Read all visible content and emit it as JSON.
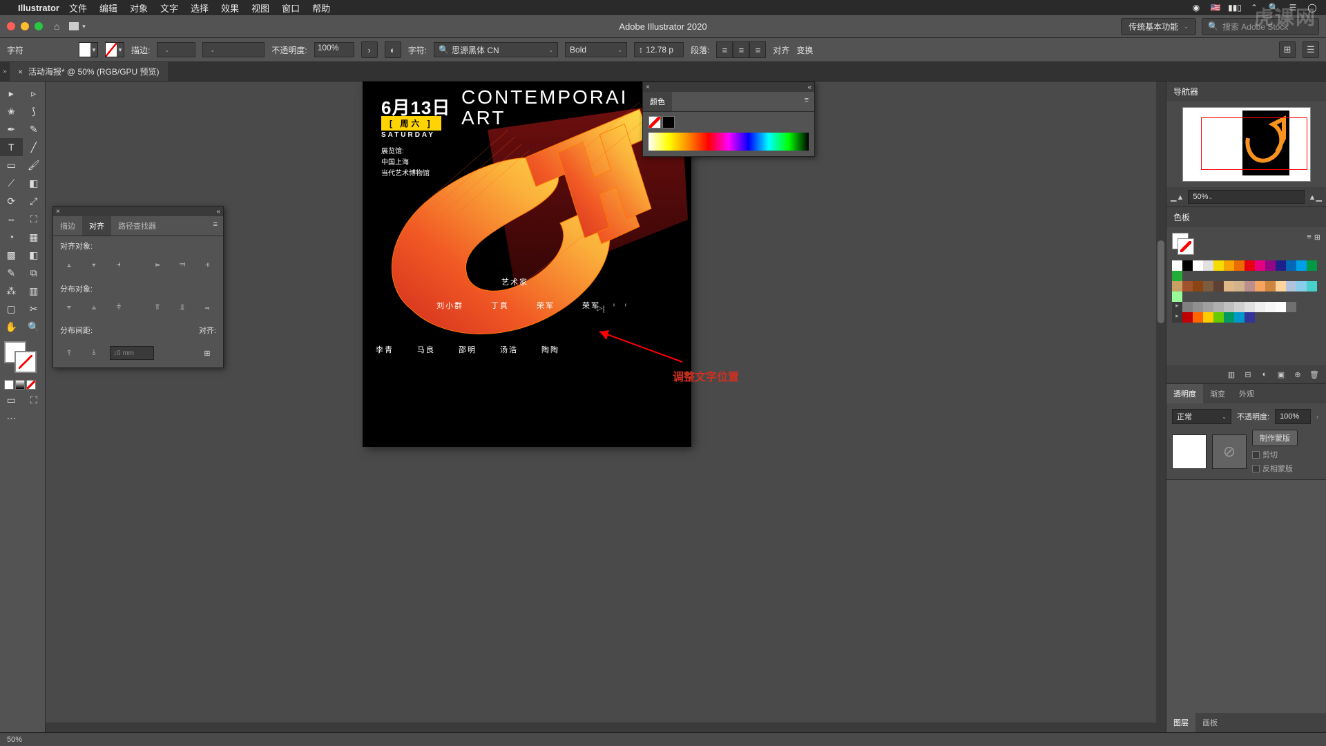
{
  "menubar": {
    "app": "Illustrator",
    "items": [
      "文件",
      "编辑",
      "对象",
      "文字",
      "选择",
      "效果",
      "视图",
      "窗口",
      "帮助"
    ]
  },
  "titlebar": {
    "title": "Adobe Illustrator 2020",
    "workspace": "传统基本功能",
    "search_placeholder": "搜索 Adobe Stock"
  },
  "watermark": "虎课网",
  "controlbar": {
    "left_label": "字符",
    "stroke_label": "描边:",
    "stroke_value": "",
    "opacity_label": "不透明度:",
    "opacity_value": "100%",
    "char_label": "字符:",
    "font_family": "思源黑体 CN",
    "font_weight": "Bold",
    "font_size": "12.78 p",
    "para_label": "段落:",
    "align_label": "对齐",
    "transform_label": "变换"
  },
  "doctab": {
    "name": "活动海报* @ 50% (RGB/GPU 预览)"
  },
  "align_panel": {
    "tabs": [
      "描边",
      "对齐",
      "路径查找器"
    ],
    "active_tab": 1,
    "sec1": "对齐对象:",
    "sec2": "分布对象:",
    "sec3": "分布间距:",
    "sec3_right": "对齐:",
    "spacing_value": "0 mm"
  },
  "color_panel": {
    "title": "颜色"
  },
  "artwork": {
    "date": "6月13日",
    "weekday": "[ 周六 ]",
    "saturday": "SATURDAY",
    "venue_label": "展览馆:",
    "venue_l1": "中国上海",
    "venue_l2": "当代艺术博物馆",
    "headline_l1": "CONTEMPORAI",
    "headline_l2": "ART",
    "artist_label": "艺术家",
    "row1": [
      "刘小群",
      "丁真",
      "荣军",
      "荣军"
    ],
    "row2": [
      "李青",
      "马良",
      "邵明",
      "汤浩",
      "陶陶"
    ],
    "cursor_glyphs": "▷ꞁ ' '"
  },
  "annotation": "调整文字位置",
  "navigator": {
    "title": "导航器",
    "zoom": "50%"
  },
  "swatches": {
    "title": "色板",
    "colors_row1": [
      "#ffffff",
      "#000000",
      "#ffffff",
      "#e0e0e0",
      "#f6dc00",
      "#f7a400",
      "#ec6c00",
      "#e60012",
      "#e4007f",
      "#920783",
      "#1d2088",
      "#0068b7",
      "#00a0e9",
      "#009944",
      "#22ac38"
    ],
    "colors_row2": [
      "#c9a063",
      "#a0522d",
      "#8b4513",
      "#7b5c3e",
      "#5c4033",
      "#deb887",
      "#d2b48c",
      "#bc8f8f",
      "#f4a460",
      "#cd853f",
      "#ffd39b",
      "#b0c4de",
      "#87ceeb",
      "#48d1cc",
      "#98fb98"
    ],
    "colors_row3": [
      "#808080",
      "#909090",
      "#a0a0a0",
      "#b0b0b0",
      "#c0c0c0",
      "#d0d0d0",
      "#e0e0e0",
      "#f0f0f0",
      "#f8f8f8",
      "#ffffff",
      "#707070"
    ],
    "colors_row4": [
      "#c00000",
      "#ff6600",
      "#ffcc00",
      "#66cc00",
      "#009966",
      "#0099cc",
      "#333399"
    ]
  },
  "transparency": {
    "tabs": [
      "透明度",
      "渐变",
      "外观"
    ],
    "active_tab": 0,
    "blend_mode": "正常",
    "opacity_label": "不透明度:",
    "opacity_value": "100%",
    "make_mask": "制作蒙版",
    "clip": "剪切",
    "invert": "反相蒙版"
  },
  "bottom_tabs": [
    "图层",
    "画板"
  ],
  "statusbar": {
    "zoom": "50%"
  }
}
